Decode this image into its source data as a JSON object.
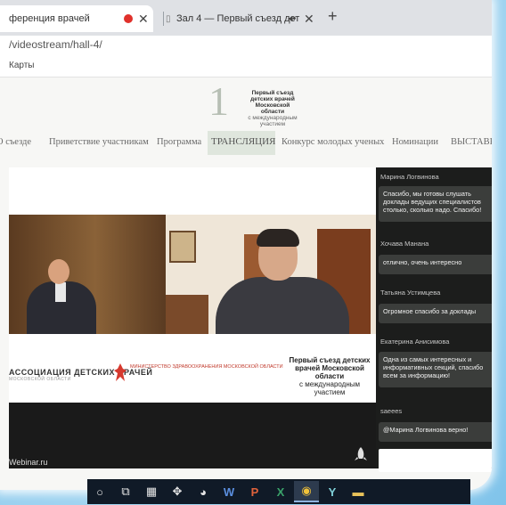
{
  "browser": {
    "tabs": [
      {
        "title": "ференция врачей",
        "close": "✕"
      },
      {
        "title": "Зал 4 — Первый съезд дет",
        "close": "✕",
        "audio": "◂•"
      }
    ],
    "new_tab": "+",
    "url": "/videostream/hall-4/",
    "bookmarks": [
      "Карты"
    ]
  },
  "site": {
    "logo": {
      "number": "1",
      "title": "Первый съезд детских врачей Московской области",
      "subtitle": "с международным участием"
    },
    "nav": [
      {
        "label": "О съезде"
      },
      {
        "label": "Приветствие участникам"
      },
      {
        "label": "Программа"
      },
      {
        "label": "ТРАНСЛЯЦИЯ",
        "active": true
      },
      {
        "label": "Конкурс молодых ученых"
      },
      {
        "label": "Номинации"
      },
      {
        "label": "ВЫСТАВКА"
      }
    ]
  },
  "stream": {
    "sponsor_left": "АССОЦИАЦИЯ ДЕТСКИХ ВРАЧЕЙ",
    "sponsor_left_sub": "МОСКОВСКОЙ ОБЛАСТИ",
    "ministry": "Министерство здравоохранения Московской области",
    "event_title": "Первый съезд детских врачей Московской области",
    "event_sub": "с международным участием",
    "platform": "Webinar.ru",
    "player_icon": "rocket-icon"
  },
  "chat": {
    "messages": [
      {
        "author": "Марина Логвинова",
        "text": "Спасибо, мы готовы слушать доклады ведущих специалистов столько, сколько надо. Спасибо!"
      },
      {
        "author": "Хочава Манана",
        "text": "отлично, очень интересно"
      },
      {
        "author": "Татьяна Устимцева",
        "text": "Огромное спасибо за доклады"
      },
      {
        "author": "Екатерина Анисимова",
        "text": "Одна из самых интересных и информативных секций, спасибо всем за информацию!"
      },
      {
        "author": "saeees",
        "text": "@Марина Логвинова верно!"
      }
    ]
  },
  "taskbar": {
    "icons": [
      {
        "name": "search",
        "glyph": "○"
      },
      {
        "name": "task-view",
        "glyph": "⧉"
      },
      {
        "name": "calculator",
        "glyph": "▦"
      },
      {
        "name": "network",
        "glyph": "✥"
      },
      {
        "name": "chat-app",
        "glyph": "◕"
      },
      {
        "name": "word",
        "glyph": "W"
      },
      {
        "name": "powerpoint",
        "glyph": "P"
      },
      {
        "name": "excel",
        "glyph": "X"
      },
      {
        "name": "chrome",
        "glyph": "◉"
      },
      {
        "name": "app-bird",
        "glyph": "Y"
      },
      {
        "name": "explorer",
        "glyph": "▬"
      }
    ]
  },
  "colors": {
    "chat_bg": "#1c1d1c",
    "bubble_bg": "#3b3d3b",
    "nav_active_bg": "#dfe6dd",
    "rec_dot": "#e0312b",
    "taskbar_bg": "#101a27"
  }
}
